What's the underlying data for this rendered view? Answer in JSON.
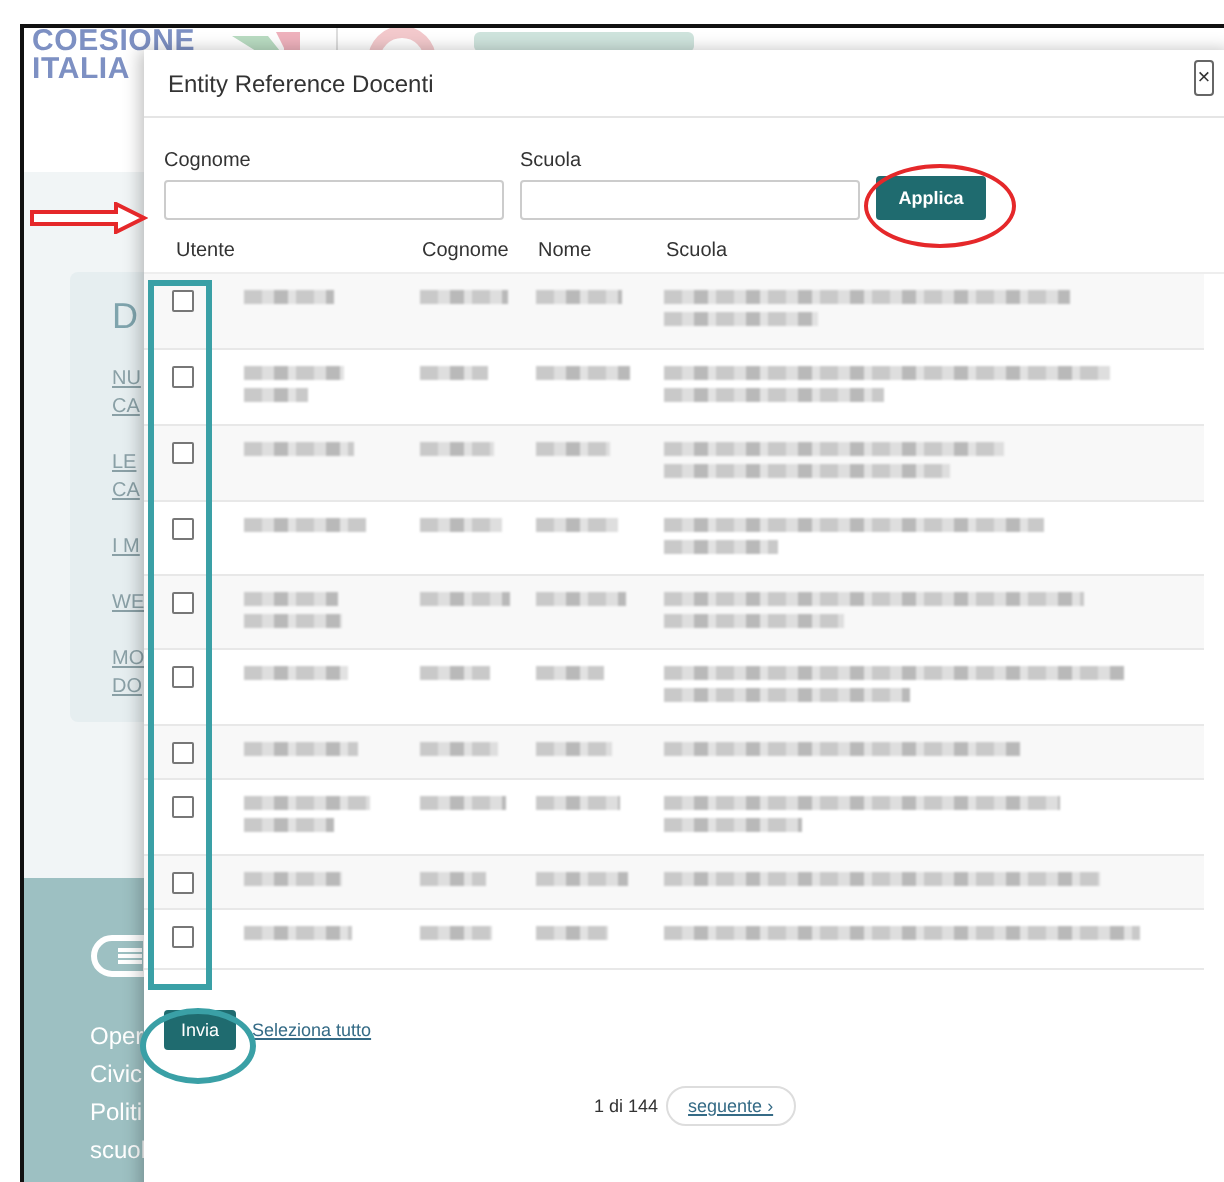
{
  "background_page": {
    "logo": [
      "COESIONE",
      "ITALIA"
    ],
    "panel": {
      "title": "D",
      "links": [
        {
          "lines": [
            "NU",
            "CA"
          ]
        },
        {
          "lines": [
            "LE",
            "CA"
          ]
        },
        {
          "lines": [
            "I M"
          ]
        },
        {
          "lines": [
            "WE"
          ]
        },
        {
          "lines": [
            "MO",
            "DO"
          ]
        }
      ]
    },
    "footer_lines": [
      "Oper",
      "Civic",
      "Politi",
      "scuol"
    ]
  },
  "modal": {
    "title": "Entity Reference Docenti",
    "close": "×",
    "filters": [
      {
        "label": "Cognome"
      },
      {
        "label": "Scuola"
      }
    ],
    "apply_button": "Applica",
    "table": {
      "columns": [
        "Utente",
        "Cognome",
        "Nome",
        "Scuola"
      ],
      "rows": [
        {
          "checked": false
        },
        {
          "checked": false
        },
        {
          "checked": false
        },
        {
          "checked": false
        },
        {
          "checked": false
        },
        {
          "checked": false
        },
        {
          "checked": false
        },
        {
          "checked": false
        },
        {
          "checked": false
        },
        {
          "checked": false
        }
      ]
    },
    "submit_button": "Invia",
    "select_all_link": "Seleziona tutto",
    "pagination": {
      "status": "1 di 144",
      "next": "seguente ›"
    }
  }
}
